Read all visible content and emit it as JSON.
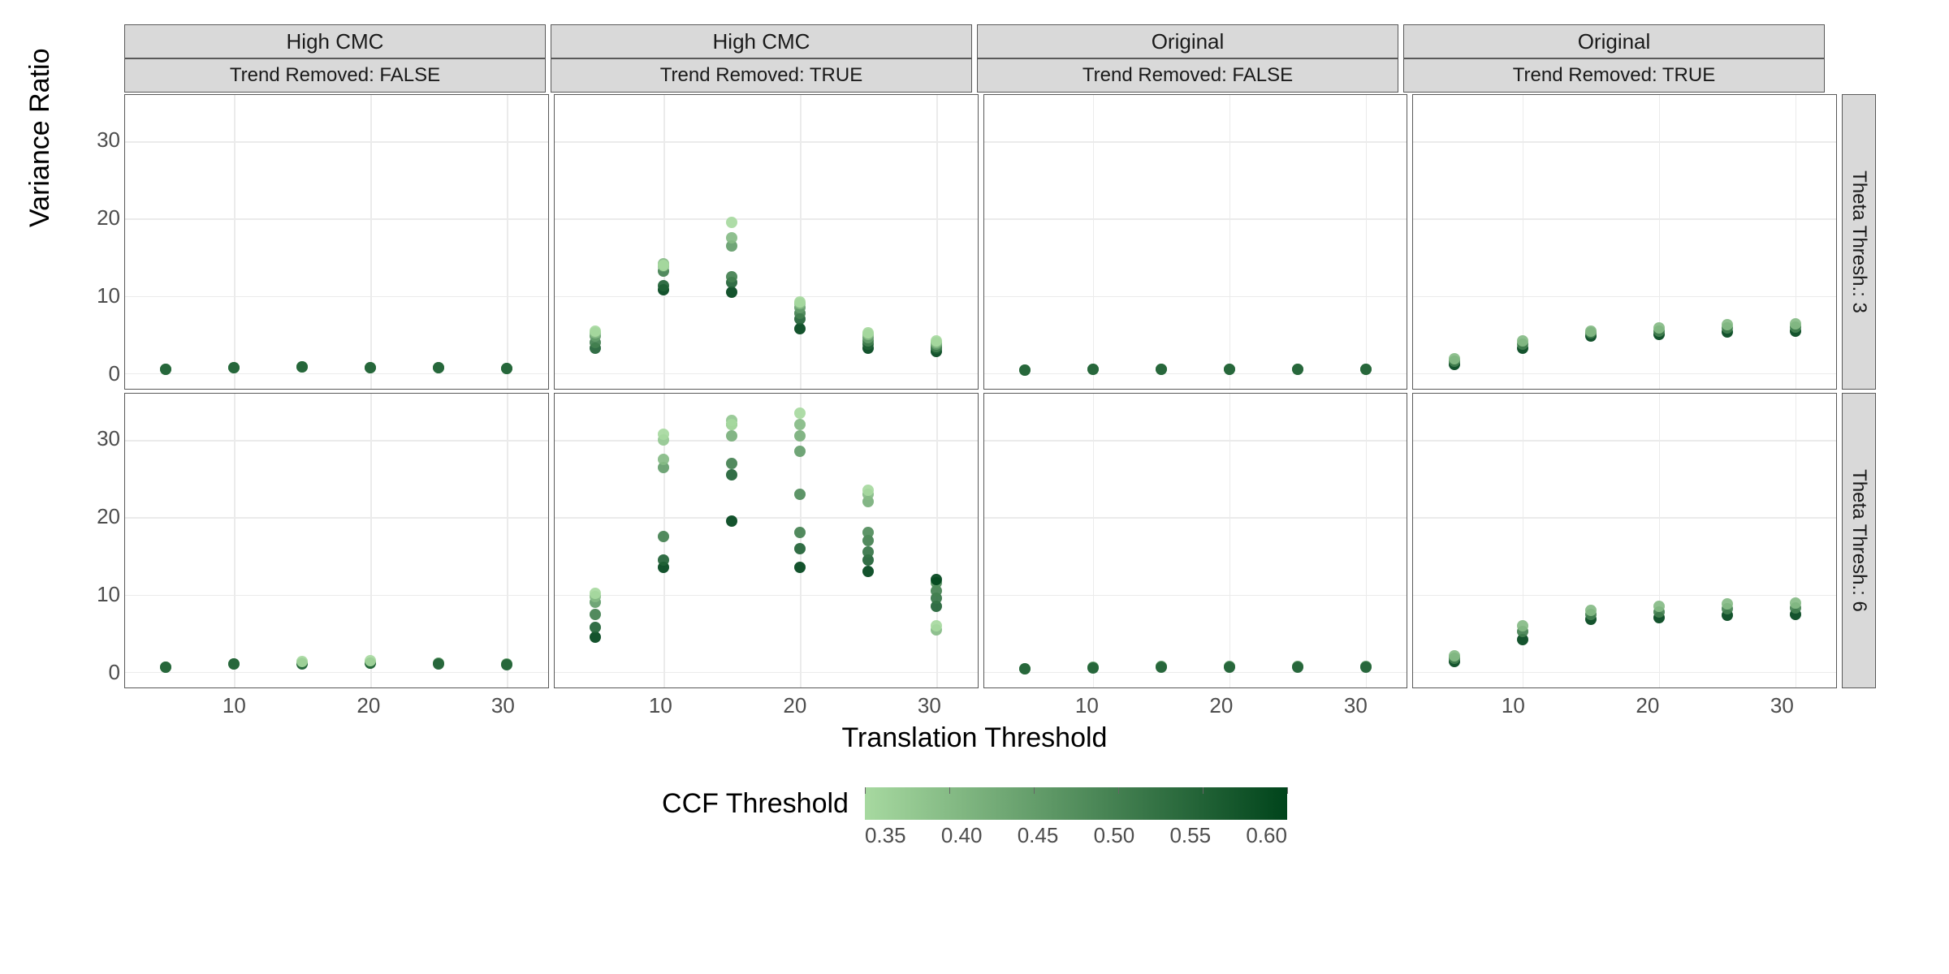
{
  "chart_data": {
    "type": "scatter",
    "xlabel": "Translation Threshold",
    "ylabel": "Variance Ratio",
    "color_legend_title": "CCF Threshold",
    "color_scale": {
      "min": 0.35,
      "max": 0.6,
      "low_color": "#a7d9a0",
      "high_color": "#00441b"
    },
    "x_ticks": [
      10,
      20,
      30
    ],
    "y_ticks": [
      0,
      10,
      20,
      30
    ],
    "legend_ticks": [
      0.35,
      0.4,
      0.45,
      0.5,
      0.55,
      0.6
    ],
    "x_range": [
      2,
      33
    ],
    "y_range": [
      -2,
      36
    ],
    "facet_cols": [
      {
        "cmc": "High CMC",
        "trend": "Trend Removed: FALSE"
      },
      {
        "cmc": "High CMC",
        "trend": "Trend Removed: TRUE"
      },
      {
        "cmc": "Original",
        "trend": "Trend Removed: FALSE"
      },
      {
        "cmc": "Original",
        "trend": "Trend Removed: TRUE"
      }
    ],
    "facet_rows": [
      {
        "theta": "Theta Thresh.: 3"
      },
      {
        "theta": "Theta Thresh.: 6"
      }
    ],
    "panels": [
      {
        "row": 0,
        "col": 0,
        "points": [
          {
            "x": 5,
            "y": 0.5,
            "c": 0.35
          },
          {
            "x": 5,
            "y": 0.5,
            "c": 0.45
          },
          {
            "x": 5,
            "y": 0.5,
            "c": 0.55
          },
          {
            "x": 10,
            "y": 0.7,
            "c": 0.35
          },
          {
            "x": 10,
            "y": 0.7,
            "c": 0.45
          },
          {
            "x": 10,
            "y": 0.7,
            "c": 0.55
          },
          {
            "x": 15,
            "y": 0.8,
            "c": 0.35
          },
          {
            "x": 15,
            "y": 0.8,
            "c": 0.45
          },
          {
            "x": 15,
            "y": 0.8,
            "c": 0.55
          },
          {
            "x": 20,
            "y": 0.7,
            "c": 0.35
          },
          {
            "x": 20,
            "y": 0.7,
            "c": 0.45
          },
          {
            "x": 20,
            "y": 0.7,
            "c": 0.55
          },
          {
            "x": 25,
            "y": 0.7,
            "c": 0.35
          },
          {
            "x": 25,
            "y": 0.7,
            "c": 0.45
          },
          {
            "x": 25,
            "y": 0.7,
            "c": 0.55
          },
          {
            "x": 30,
            "y": 0.6,
            "c": 0.35
          },
          {
            "x": 30,
            "y": 0.6,
            "c": 0.45
          },
          {
            "x": 30,
            "y": 0.6,
            "c": 0.55
          }
        ]
      },
      {
        "row": 0,
        "col": 1,
        "points": [
          {
            "x": 5,
            "y": 3.2,
            "c": 0.55
          },
          {
            "x": 5,
            "y": 4.0,
            "c": 0.5
          },
          {
            "x": 5,
            "y": 4.8,
            "c": 0.45
          },
          {
            "x": 5,
            "y": 5.2,
            "c": 0.4
          },
          {
            "x": 5,
            "y": 5.5,
            "c": 0.35
          },
          {
            "x": 10,
            "y": 10.8,
            "c": 0.6
          },
          {
            "x": 10,
            "y": 11.3,
            "c": 0.55
          },
          {
            "x": 10,
            "y": 13.2,
            "c": 0.5
          },
          {
            "x": 10,
            "y": 13.9,
            "c": 0.45
          },
          {
            "x": 10,
            "y": 14.2,
            "c": 0.4
          },
          {
            "x": 10,
            "y": 14.0,
            "c": 0.35
          },
          {
            "x": 15,
            "y": 10.5,
            "c": 0.6
          },
          {
            "x": 15,
            "y": 11.8,
            "c": 0.55
          },
          {
            "x": 15,
            "y": 12.5,
            "c": 0.5
          },
          {
            "x": 15,
            "y": 16.5,
            "c": 0.45
          },
          {
            "x": 15,
            "y": 17.5,
            "c": 0.4
          },
          {
            "x": 15,
            "y": 19.5,
            "c": 0.35
          },
          {
            "x": 20,
            "y": 5.8,
            "c": 0.6
          },
          {
            "x": 20,
            "y": 7.0,
            "c": 0.55
          },
          {
            "x": 20,
            "y": 7.8,
            "c": 0.5
          },
          {
            "x": 20,
            "y": 8.5,
            "c": 0.45
          },
          {
            "x": 20,
            "y": 9.0,
            "c": 0.4
          },
          {
            "x": 20,
            "y": 9.2,
            "c": 0.35
          },
          {
            "x": 25,
            "y": 3.2,
            "c": 0.6
          },
          {
            "x": 25,
            "y": 3.8,
            "c": 0.55
          },
          {
            "x": 25,
            "y": 4.2,
            "c": 0.5
          },
          {
            "x": 25,
            "y": 4.6,
            "c": 0.45
          },
          {
            "x": 25,
            "y": 5.0,
            "c": 0.4
          },
          {
            "x": 25,
            "y": 5.2,
            "c": 0.35
          },
          {
            "x": 30,
            "y": 2.8,
            "c": 0.6
          },
          {
            "x": 30,
            "y": 3.2,
            "c": 0.55
          },
          {
            "x": 30,
            "y": 3.5,
            "c": 0.5
          },
          {
            "x": 30,
            "y": 3.8,
            "c": 0.45
          },
          {
            "x": 30,
            "y": 4.0,
            "c": 0.4
          },
          {
            "x": 30,
            "y": 4.2,
            "c": 0.35
          }
        ]
      },
      {
        "row": 0,
        "col": 2,
        "points": [
          {
            "x": 5,
            "y": 0.4,
            "c": 0.45
          },
          {
            "x": 10,
            "y": 0.5,
            "c": 0.45
          },
          {
            "x": 15,
            "y": 0.5,
            "c": 0.45
          },
          {
            "x": 20,
            "y": 0.5,
            "c": 0.45
          },
          {
            "x": 25,
            "y": 0.5,
            "c": 0.45
          },
          {
            "x": 30,
            "y": 0.5,
            "c": 0.45
          },
          {
            "x": 5,
            "y": 0.4,
            "c": 0.55
          },
          {
            "x": 10,
            "y": 0.5,
            "c": 0.55
          },
          {
            "x": 15,
            "y": 0.5,
            "c": 0.55
          },
          {
            "x": 20,
            "y": 0.5,
            "c": 0.55
          },
          {
            "x": 25,
            "y": 0.5,
            "c": 0.55
          },
          {
            "x": 30,
            "y": 0.5,
            "c": 0.55
          }
        ]
      },
      {
        "row": 0,
        "col": 3,
        "points": [
          {
            "x": 5,
            "y": 1.2,
            "c": 0.6
          },
          {
            "x": 5,
            "y": 1.6,
            "c": 0.5
          },
          {
            "x": 5,
            "y": 1.9,
            "c": 0.4
          },
          {
            "x": 10,
            "y": 3.2,
            "c": 0.6
          },
          {
            "x": 10,
            "y": 3.8,
            "c": 0.5
          },
          {
            "x": 10,
            "y": 4.2,
            "c": 0.4
          },
          {
            "x": 15,
            "y": 4.8,
            "c": 0.6
          },
          {
            "x": 15,
            "y": 5.2,
            "c": 0.5
          },
          {
            "x": 15,
            "y": 5.5,
            "c": 0.4
          },
          {
            "x": 20,
            "y": 5.0,
            "c": 0.6
          },
          {
            "x": 20,
            "y": 5.5,
            "c": 0.5
          },
          {
            "x": 20,
            "y": 5.9,
            "c": 0.4
          },
          {
            "x": 25,
            "y": 5.3,
            "c": 0.6
          },
          {
            "x": 25,
            "y": 5.9,
            "c": 0.5
          },
          {
            "x": 25,
            "y": 6.3,
            "c": 0.4
          },
          {
            "x": 30,
            "y": 5.5,
            "c": 0.6
          },
          {
            "x": 30,
            "y": 6.0,
            "c": 0.5
          },
          {
            "x": 30,
            "y": 6.4,
            "c": 0.4
          }
        ]
      },
      {
        "row": 1,
        "col": 0,
        "points": [
          {
            "x": 5,
            "y": 0.6,
            "c": 0.45
          },
          {
            "x": 10,
            "y": 1.0,
            "c": 0.45
          },
          {
            "x": 15,
            "y": 1.1,
            "c": 0.45
          },
          {
            "x": 20,
            "y": 1.2,
            "c": 0.45
          },
          {
            "x": 25,
            "y": 1.1,
            "c": 0.45
          },
          {
            "x": 30,
            "y": 1.0,
            "c": 0.45
          },
          {
            "x": 5,
            "y": 0.6,
            "c": 0.55
          },
          {
            "x": 10,
            "y": 1.0,
            "c": 0.55
          },
          {
            "x": 15,
            "y": 1.0,
            "c": 0.55
          },
          {
            "x": 20,
            "y": 1.1,
            "c": 0.55
          },
          {
            "x": 25,
            "y": 1.0,
            "c": 0.55
          },
          {
            "x": 30,
            "y": 0.9,
            "c": 0.55
          },
          {
            "x": 15,
            "y": 1.4,
            "c": 0.35
          },
          {
            "x": 20,
            "y": 1.5,
            "c": 0.35
          }
        ]
      },
      {
        "row": 1,
        "col": 1,
        "points": [
          {
            "x": 5,
            "y": 4.5,
            "c": 0.6
          },
          {
            "x": 5,
            "y": 5.8,
            "c": 0.55
          },
          {
            "x": 5,
            "y": 7.5,
            "c": 0.5
          },
          {
            "x": 5,
            "y": 9.0,
            "c": 0.45
          },
          {
            "x": 5,
            "y": 9.8,
            "c": 0.4
          },
          {
            "x": 5,
            "y": 10.2,
            "c": 0.35
          },
          {
            "x": 10,
            "y": 13.5,
            "c": 0.6
          },
          {
            "x": 10,
            "y": 14.5,
            "c": 0.55
          },
          {
            "x": 10,
            "y": 17.5,
            "c": 0.5
          },
          {
            "x": 10,
            "y": 26.5,
            "c": 0.45
          },
          {
            "x": 10,
            "y": 27.5,
            "c": 0.4
          },
          {
            "x": 10,
            "y": 30.0,
            "c": 0.38
          },
          {
            "x": 10,
            "y": 30.8,
            "c": 0.35
          },
          {
            "x": 15,
            "y": 19.5,
            "c": 0.6
          },
          {
            "x": 15,
            "y": 25.5,
            "c": 0.55
          },
          {
            "x": 15,
            "y": 27.0,
            "c": 0.5
          },
          {
            "x": 15,
            "y": 32.0,
            "c": 0.45
          },
          {
            "x": 15,
            "y": 30.5,
            "c": 0.42
          },
          {
            "x": 15,
            "y": 32.5,
            "c": 0.38
          },
          {
            "x": 15,
            "y": 32.0,
            "c": 0.35
          },
          {
            "x": 20,
            "y": 13.5,
            "c": 0.6
          },
          {
            "x": 20,
            "y": 16.0,
            "c": 0.55
          },
          {
            "x": 20,
            "y": 18.0,
            "c": 0.5
          },
          {
            "x": 20,
            "y": 23.0,
            "c": 0.48
          },
          {
            "x": 20,
            "y": 28.5,
            "c": 0.45
          },
          {
            "x": 20,
            "y": 30.5,
            "c": 0.42
          },
          {
            "x": 20,
            "y": 32.0,
            "c": 0.4
          },
          {
            "x": 20,
            "y": 33.5,
            "c": 0.35
          },
          {
            "x": 25,
            "y": 13.0,
            "c": 0.6
          },
          {
            "x": 25,
            "y": 14.5,
            "c": 0.55
          },
          {
            "x": 25,
            "y": 15.5,
            "c": 0.52
          },
          {
            "x": 25,
            "y": 17.0,
            "c": 0.5
          },
          {
            "x": 25,
            "y": 18.0,
            "c": 0.48
          },
          {
            "x": 25,
            "y": 22.0,
            "c": 0.42
          },
          {
            "x": 25,
            "y": 23.0,
            "c": 0.4
          },
          {
            "x": 25,
            "y": 23.5,
            "c": 0.35
          },
          {
            "x": 30,
            "y": 5.5,
            "c": 0.4
          },
          {
            "x": 30,
            "y": 6.0,
            "c": 0.35
          },
          {
            "x": 30,
            "y": 8.5,
            "c": 0.55
          },
          {
            "x": 30,
            "y": 9.5,
            "c": 0.52
          },
          {
            "x": 30,
            "y": 10.5,
            "c": 0.5
          },
          {
            "x": 30,
            "y": 11.5,
            "c": 0.48
          },
          {
            "x": 30,
            "y": 12.0,
            "c": 0.6
          }
        ]
      },
      {
        "row": 1,
        "col": 2,
        "points": [
          {
            "x": 5,
            "y": 0.4,
            "c": 0.45
          },
          {
            "x": 10,
            "y": 0.6,
            "c": 0.45
          },
          {
            "x": 15,
            "y": 0.7,
            "c": 0.45
          },
          {
            "x": 20,
            "y": 0.7,
            "c": 0.45
          },
          {
            "x": 25,
            "y": 0.7,
            "c": 0.45
          },
          {
            "x": 30,
            "y": 0.7,
            "c": 0.45
          },
          {
            "x": 5,
            "y": 0.4,
            "c": 0.55
          },
          {
            "x": 10,
            "y": 0.5,
            "c": 0.55
          },
          {
            "x": 15,
            "y": 0.6,
            "c": 0.55
          },
          {
            "x": 20,
            "y": 0.6,
            "c": 0.55
          },
          {
            "x": 25,
            "y": 0.6,
            "c": 0.55
          },
          {
            "x": 30,
            "y": 0.6,
            "c": 0.55
          }
        ]
      },
      {
        "row": 1,
        "col": 3,
        "points": [
          {
            "x": 5,
            "y": 1.4,
            "c": 0.6
          },
          {
            "x": 5,
            "y": 1.8,
            "c": 0.5
          },
          {
            "x": 5,
            "y": 2.1,
            "c": 0.4
          },
          {
            "x": 10,
            "y": 4.2,
            "c": 0.6
          },
          {
            "x": 10,
            "y": 5.2,
            "c": 0.5
          },
          {
            "x": 10,
            "y": 6.0,
            "c": 0.4
          },
          {
            "x": 15,
            "y": 6.8,
            "c": 0.6
          },
          {
            "x": 15,
            "y": 7.5,
            "c": 0.5
          },
          {
            "x": 15,
            "y": 8.0,
            "c": 0.4
          },
          {
            "x": 20,
            "y": 7.0,
            "c": 0.6
          },
          {
            "x": 20,
            "y": 7.8,
            "c": 0.5
          },
          {
            "x": 20,
            "y": 8.5,
            "c": 0.4
          },
          {
            "x": 25,
            "y": 7.3,
            "c": 0.6
          },
          {
            "x": 25,
            "y": 8.2,
            "c": 0.5
          },
          {
            "x": 25,
            "y": 8.8,
            "c": 0.4
          },
          {
            "x": 30,
            "y": 7.5,
            "c": 0.6
          },
          {
            "x": 30,
            "y": 8.3,
            "c": 0.5
          },
          {
            "x": 30,
            "y": 8.9,
            "c": 0.4
          }
        ]
      }
    ]
  }
}
